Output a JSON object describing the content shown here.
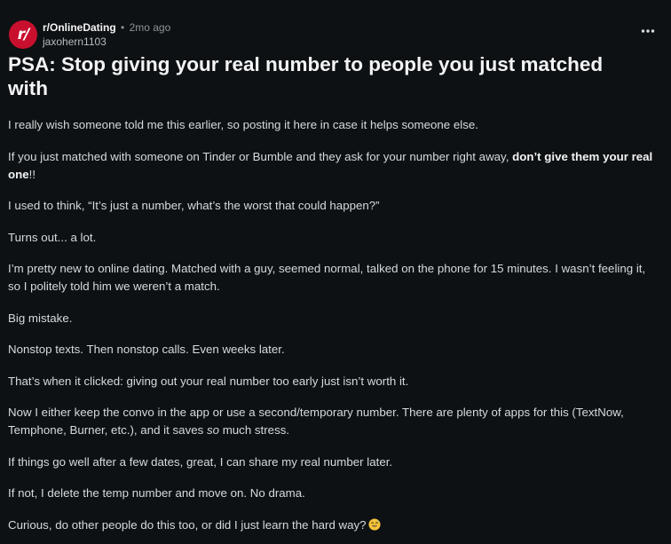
{
  "post": {
    "subreddit": "r/OnlineDating",
    "separator": "•",
    "time_ago": "2mo ago",
    "author": "jaxohern1103",
    "avatar_text": "r/",
    "title": "PSA: Stop giving your real number to people you just matched with",
    "paragraphs": {
      "p1": "I really wish someone told me this earlier, so posting it here in case it helps someone else.",
      "p2_before": "If you just matched with someone on Tinder or Bumble and they ask for your number right away, ",
      "p2_bold": "don’t give them your real one",
      "p2_after": "!!",
      "p3": "I used to think, “It’s just a number, what’s the worst that could happen?”",
      "p4": "Turns out... a lot.",
      "p5": "I’m pretty new to online dating. Matched with a guy, seemed normal, talked on the phone for 15 minutes. I wasn’t feeling it, so I politely told him we weren’t a match.",
      "p6": "Big mistake.",
      "p7": "Nonstop texts. Then nonstop calls. Even weeks later.",
      "p8": "That’s when it clicked: giving out your real number too early just isn’t worth it.",
      "p9_before": "Now I either keep the convo in the app or use a second/temporary number. There are plenty of apps for this (TextNow, Temphone, Burner, etc.), and it saves ",
      "p9_italic": "so",
      "p9_after": " much stress.",
      "p10": "If things go well after a few dates, great, I can share my real number later.",
      "p11": "If not, I delete the temp number and move on. No drama.",
      "p12": "Curious, do other people do this too, or did I just learn the hard way?"
    },
    "icons": {
      "more": "more-options-icon",
      "emoji": "sweat-smile-emoji-icon"
    },
    "colors": {
      "avatar_bg": "#c8102e",
      "background": "#0e1113",
      "text": "#d7dadc"
    }
  }
}
